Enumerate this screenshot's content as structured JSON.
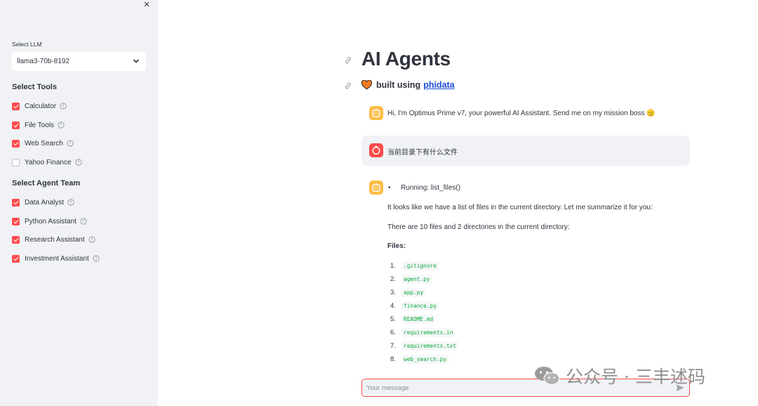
{
  "sidebar": {
    "close_label": "×",
    "llm_label": "Select LLM",
    "llm_value": "llama3-70b-8192",
    "tools_title": "Select Tools",
    "tools": [
      {
        "label": "Calculator",
        "checked": true
      },
      {
        "label": "File Tools",
        "checked": true
      },
      {
        "label": "Web Search",
        "checked": true
      },
      {
        "label": "Yahoo Finance",
        "checked": false
      }
    ],
    "team_title": "Select Agent Team",
    "team": [
      {
        "label": "Data Analyst",
        "checked": true
      },
      {
        "label": "Python Assistant",
        "checked": true
      },
      {
        "label": "Research Assistant",
        "checked": true
      },
      {
        "label": "Investment Assistant",
        "checked": true
      }
    ]
  },
  "main": {
    "title": "AI Agents",
    "subtitle_prefix": "built using",
    "subtitle_link": "phidata",
    "messages": {
      "greeting": "Hi, I'm Optimus Prime v7, your powerful AI Assistant. Send me on my mission boss",
      "greeting_emoji": "🫡",
      "user_query": "当前目录下有什么文件",
      "running": "Running: list_files()",
      "summary": "It looks like we have a list of files in the current directory. Let me summarize it for you:",
      "count": "There are 10 files and 2 directories in the current directory:",
      "files_heading": "Files:",
      "files": [
        {
          "num": "1.",
          "name": ".gitignore"
        },
        {
          "num": "2.",
          "name": "agent.py"
        },
        {
          "num": "3.",
          "name": "app.py"
        },
        {
          "num": "4.",
          "name": "finance.py"
        },
        {
          "num": "5.",
          "name": "README.md"
        },
        {
          "num": "6.",
          "name": "requirements.in"
        },
        {
          "num": "7.",
          "name": "requirements.txt"
        },
        {
          "num": "8.",
          "name": "web_search.py"
        }
      ]
    },
    "chat_input": {
      "placeholder": "Your message"
    }
  },
  "watermark": "公众号 · 三丰述码",
  "colors": {
    "accent": "#ff4b4b",
    "bot_avatar": "#ffbd45",
    "sidebar_bg": "#f0f2f6",
    "link": "#1c4ed8",
    "code_text": "#09ab3b"
  }
}
